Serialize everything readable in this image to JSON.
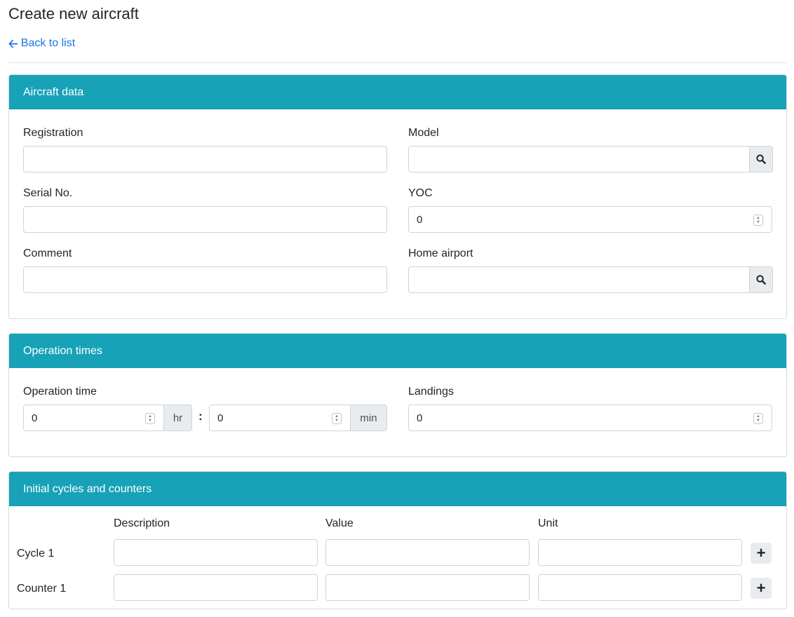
{
  "page": {
    "title": "Create new aircraft",
    "back_link": "Back to list"
  },
  "aircraft_data": {
    "header": "Aircraft data",
    "registration": {
      "label": "Registration",
      "value": ""
    },
    "model": {
      "label": "Model",
      "value": ""
    },
    "serial_no": {
      "label": "Serial No.",
      "value": ""
    },
    "yoc": {
      "label": "YOC",
      "value": "0"
    },
    "comment": {
      "label": "Comment",
      "value": ""
    },
    "home_airport": {
      "label": "Home airport",
      "value": ""
    }
  },
  "operation_times": {
    "header": "Operation times",
    "operation_time": {
      "label": "Operation time",
      "hours": "0",
      "hours_unit": "hr",
      "separator": ":",
      "minutes": "0",
      "minutes_unit": "min"
    },
    "landings": {
      "label": "Landings",
      "value": "0"
    }
  },
  "cycles_counters": {
    "header": "Initial cycles and counters",
    "columns": [
      "Description",
      "Value",
      "Unit"
    ],
    "rows": [
      {
        "label": "Cycle 1",
        "description": "",
        "value": "",
        "unit": ""
      },
      {
        "label": "Counter 1",
        "description": "",
        "value": "",
        "unit": ""
      }
    ],
    "add_label": "+"
  },
  "icons": {
    "back": "arrow-left-icon",
    "lookup": "search-icon",
    "stepper": "spinner-icon",
    "add": "plus-icon"
  },
  "colors": {
    "header_bg": "#17a2b8",
    "link": "#1a73e8",
    "addon_bg": "#e9ecef"
  }
}
